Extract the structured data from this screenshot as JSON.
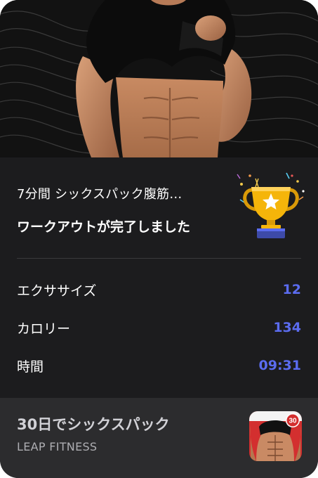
{
  "workout": {
    "subtitle": "7分間 シックスパック腹筋…",
    "title": "ワークアウトが完了しました"
  },
  "stats": [
    {
      "label": "エクササイズ",
      "value": "12"
    },
    {
      "label": "カロリー",
      "value": "134"
    },
    {
      "label": "時間",
      "value": "09:31"
    }
  ],
  "app": {
    "name": "30日でシックスパック",
    "developer": "LEAP FITNESS",
    "icon_badge": "30"
  },
  "colors": {
    "accent": "#5b6cf0",
    "background": "#1c1c1e",
    "app_bar": "#2c2c2e",
    "trophy_gold": "#f5b50a"
  },
  "icons": {
    "hero": "fitness-hero-image",
    "trophy": "trophy-icon",
    "app": "app-icon"
  }
}
